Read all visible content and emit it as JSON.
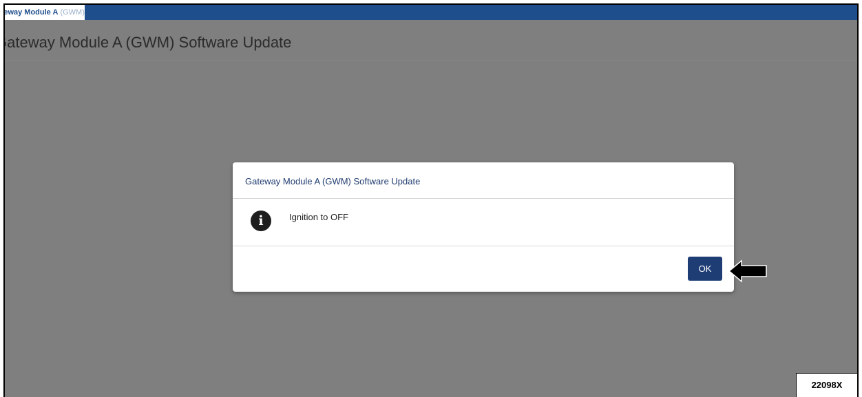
{
  "tab": {
    "label": "Gateway Module A (GWM) Software Update",
    "visible_label_strong": "Gateway Module A",
    "visible_label_faded": " (GWM)"
  },
  "page": {
    "title": "Gateway Module A (GWM) Software Update"
  },
  "dialog": {
    "title": "Gateway Module A (GWM) Software Update",
    "icon": "info-icon",
    "message": "Ignition to OFF",
    "ok_label": "OK"
  },
  "figure": {
    "number": "22098X"
  },
  "colors": {
    "topbar": "#1f4e8c",
    "overlay": "#7f7f7f",
    "button": "#1f3d75"
  }
}
